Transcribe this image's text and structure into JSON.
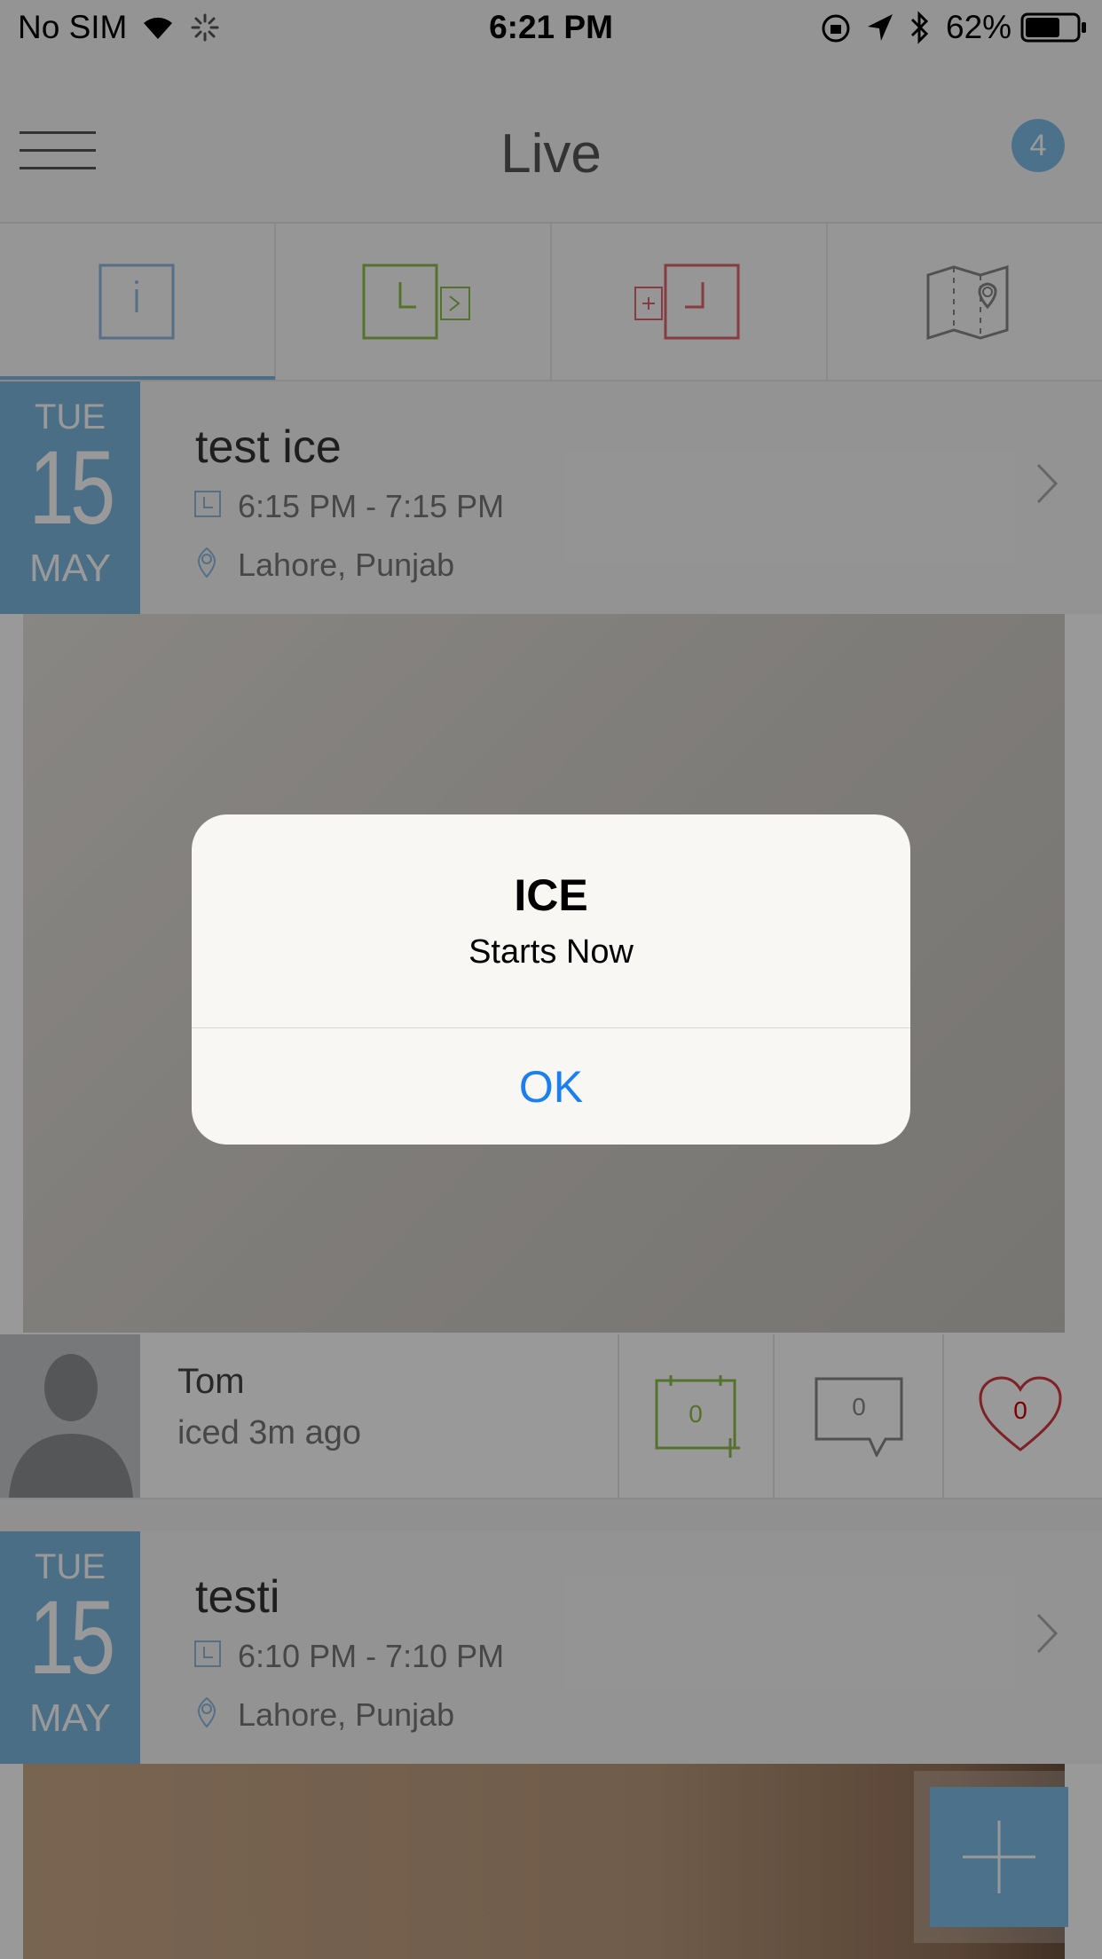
{
  "status_bar": {
    "carrier": "No SIM",
    "time": "6:21 PM",
    "battery": "62%"
  },
  "nav": {
    "title": "Live",
    "badge": "4"
  },
  "tabs": [
    {
      "name": "info",
      "color": "#8cb9e0"
    },
    {
      "name": "upcoming",
      "color": "#8ebc4e"
    },
    {
      "name": "add",
      "color": "#e0656b"
    },
    {
      "name": "map",
      "color": "#888888"
    }
  ],
  "events": [
    {
      "dow": "TUE",
      "day": "15",
      "month": "MAY",
      "title": "test ice",
      "time": "6:15 PM - 7:15 PM",
      "location": "Lahore, Punjab"
    },
    {
      "dow": "TUE",
      "day": "15",
      "month": "MAY",
      "title": "testi",
      "time": "6:10 PM - 7:10 PM",
      "location": "Lahore, Punjab"
    }
  ],
  "post": {
    "user": "Tom",
    "subtitle": "iced 3m ago",
    "calendar_count": "0",
    "comment_count": "0",
    "like_count": "0"
  },
  "alert": {
    "title": "ICE",
    "message": "Starts Now",
    "button": "OK"
  }
}
